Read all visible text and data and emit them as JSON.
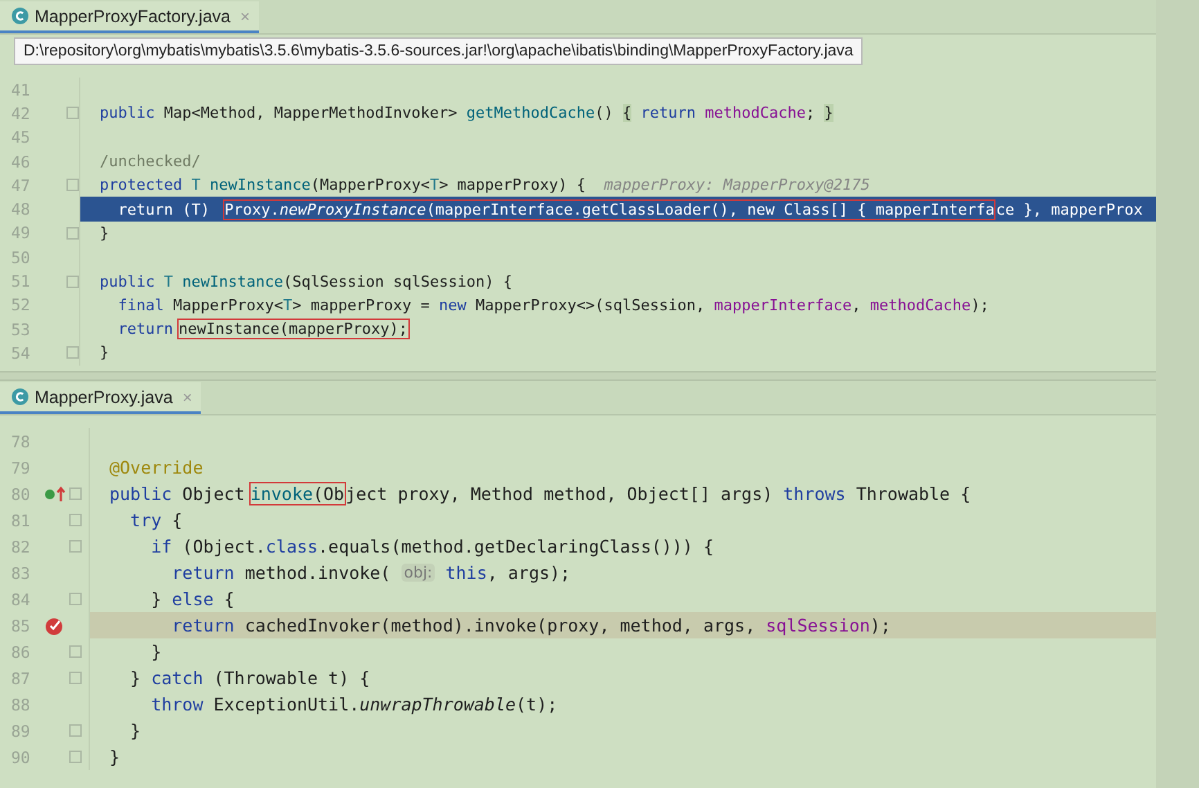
{
  "panes": [
    {
      "tab": {
        "title": "MapperProxyFactory.java",
        "close": "×",
        "selected": true
      },
      "tooltip": "D:\\repository\\org\\mybatis\\mybatis\\3.5.6\\mybatis-3.5.6-sources.jar!\\org\\apache\\ibatis\\binding\\MapperProxyFactory.java",
      "lines": [
        {
          "number": "41",
          "kind": "normal",
          "fold": false
        },
        {
          "number": "42",
          "kind": "normal",
          "fold": true,
          "code": [
            {
              "text": "public",
              "kind": "kw"
            },
            {
              "text": " Map<Method, MapperMethodInvoker> ",
              "kind": "plain"
            },
            {
              "text": "getMethodCache",
              "kind": "fn"
            },
            {
              "text": "() ",
              "kind": "plain"
            },
            {
              "text": "{",
              "kind": "fold"
            },
            {
              "text": " return",
              "kind": "kw"
            },
            {
              "text": " methodCache",
              "kind": "field"
            },
            {
              "text": "; ",
              "kind": "plain"
            },
            {
              "text": "}",
              "kind": "fold"
            }
          ]
        },
        {
          "number": "45",
          "kind": "normal",
          "fold": false
        },
        {
          "number": "46",
          "kind": "normal",
          "fold": false,
          "code": [
            {
              "text": "/unchecked/",
              "kind": "comment"
            }
          ]
        },
        {
          "number": "47",
          "kind": "normal",
          "fold": true,
          "code": [
            {
              "text": "protected",
              "kind": "kw"
            },
            {
              "text": " T",
              "kind": "tparam"
            },
            {
              "text": " newInstance",
              "kind": "fn"
            },
            {
              "text": "(MapperProxy<",
              "kind": "plain"
            },
            {
              "text": "T",
              "kind": "tparam"
            },
            {
              "text": "> mapperProxy) {",
              "kind": "plain"
            },
            {
              "text": "  mapperProxy: MapperProxy@2175",
              "kind": "debug"
            }
          ]
        },
        {
          "number": "48",
          "kind": "execution",
          "fold": false,
          "code": [
            {
              "text": "  return (T) ",
              "kind": "plain"
            }
          ],
          "boxed": [
            {
              "text": "Proxy.",
              "kind": "plain"
            },
            {
              "text": "newProxyInstance",
              "kind": "static"
            },
            {
              "text": "(mapperInterface.getClassLoader(), new Class[] { mapperInterfa",
              "kind": "plain"
            }
          ],
          "code_after": [
            {
              "text": "ce }, mapperProx",
              "kind": "plain"
            }
          ]
        },
        {
          "number": "49",
          "kind": "normal",
          "fold": true,
          "code": [
            {
              "text": "}",
              "kind": "plain"
            }
          ]
        },
        {
          "number": "50",
          "kind": "normal",
          "fold": false
        },
        {
          "number": "51",
          "kind": "normal",
          "fold": true,
          "code": [
            {
              "text": "public",
              "kind": "kw"
            },
            {
              "text": " T",
              "kind": "tparam"
            },
            {
              "text": " newInstance",
              "kind": "fn"
            },
            {
              "text": "(SqlSession sqlSession) {",
              "kind": "plain"
            }
          ]
        },
        {
          "number": "52",
          "kind": "normal",
          "fold": false,
          "code": [
            {
              "text": "  final",
              "kind": "kw"
            },
            {
              "text": " MapperProxy<",
              "kind": "plain"
            },
            {
              "text": "T",
              "kind": "tparam"
            },
            {
              "text": "> mapperProxy = ",
              "kind": "plain"
            },
            {
              "text": "new",
              "kind": "kw"
            },
            {
              "text": " MapperProxy<>(sqlSession, ",
              "kind": "plain"
            },
            {
              "text": "mapperInterface",
              "kind": "field"
            },
            {
              "text": ", ",
              "kind": "plain"
            },
            {
              "text": "methodCache",
              "kind": "field"
            },
            {
              "text": ");",
              "kind": "plain"
            }
          ]
        },
        {
          "number": "53",
          "kind": "normal",
          "fold": false,
          "code": [
            {
              "text": "  return",
              "kind": "kw"
            }
          ],
          "boxed": [
            {
              "text": "newInstance(mapperProxy);",
              "kind": "plain"
            }
          ]
        },
        {
          "number": "54",
          "kind": "normal",
          "fold": true,
          "code": [
            {
              "text": "}",
              "kind": "plain"
            }
          ]
        }
      ]
    },
    {
      "tab": {
        "title": "MapperProxy.java",
        "close": "×",
        "selected": true
      },
      "lines": [
        {
          "number": "78",
          "kind": "normal",
          "fold": false
        },
        {
          "number": "79",
          "kind": "normal",
          "fold": false,
          "code": [
            {
              "text": "@Override",
              "kind": "annotation"
            }
          ]
        },
        {
          "number": "80",
          "kind": "normal",
          "fold": true,
          "marker": {
            "kind": "override"
          },
          "code": [
            {
              "text": "public",
              "kind": "kw"
            },
            {
              "text": " Object",
              "kind": "plain"
            }
          ],
          "boxed": [
            {
              "text": "invoke",
              "kind": "fn"
            },
            {
              "text": "(Ob",
              "kind": "plain"
            }
          ],
          "code_after": [
            {
              "text": "ject proxy, Method method, Object[] args) ",
              "kind": "plain"
            },
            {
              "text": "throws",
              "kind": "kw"
            },
            {
              "text": " Throwable {",
              "kind": "plain"
            }
          ]
        },
        {
          "number": "81",
          "kind": "normal",
          "fold": true,
          "code": [
            {
              "text": "  try",
              "kind": "kw"
            },
            {
              "text": " {",
              "kind": "plain"
            }
          ]
        },
        {
          "number": "82",
          "kind": "normal",
          "fold": true,
          "code": [
            {
              "text": "    if",
              "kind": "kw"
            },
            {
              "text": " (Object.",
              "kind": "plain"
            },
            {
              "text": "class",
              "kind": "kw"
            },
            {
              "text": ".equals(method.getDeclaringClass())) {",
              "kind": "plain"
            }
          ]
        },
        {
          "number": "83",
          "kind": "normal",
          "fold": false,
          "code": [
            {
              "text": "      return",
              "kind": "kw"
            },
            {
              "text": " method.invoke( ",
              "kind": "plain"
            },
            {
              "text": "obj:",
              "kind": "inlay"
            },
            {
              "text": " this",
              "kind": "kw"
            },
            {
              "text": ", args);",
              "kind": "plain"
            }
          ]
        },
        {
          "number": "84",
          "kind": "normal",
          "fold": true,
          "code": [
            {
              "text": "    }",
              "kind": "plain"
            },
            {
              "text": " else",
              "kind": "kw"
            },
            {
              "text": " {",
              "kind": "plain"
            }
          ]
        },
        {
          "number": "85",
          "kind": "breakpoint",
          "fold": false,
          "code": [
            {
              "text": "      return",
              "kind": "kw"
            },
            {
              "text": " cachedInvoker(method).invoke(proxy, method, args, ",
              "kind": "plain"
            },
            {
              "text": "sqlSession",
              "kind": "field"
            },
            {
              "text": ");",
              "kind": "plain"
            }
          ]
        },
        {
          "number": "86",
          "kind": "normal",
          "fold": true,
          "code": [
            {
              "text": "    }",
              "kind": "plain"
            }
          ]
        },
        {
          "number": "87",
          "kind": "normal",
          "fold": true,
          "code": [
            {
              "text": "  }",
              "kind": "plain"
            },
            {
              "text": " catch",
              "kind": "kw"
            },
            {
              "text": " (Throwable t) {",
              "kind": "plain"
            }
          ]
        },
        {
          "number": "88",
          "kind": "normal",
          "fold": false,
          "code": [
            {
              "text": "    throw",
              "kind": "kw"
            },
            {
              "text": " ExceptionUtil.",
              "kind": "plain"
            },
            {
              "text": "unwrapThrowable",
              "kind": "static"
            },
            {
              "text": "(t);",
              "kind": "plain"
            }
          ]
        },
        {
          "number": "89",
          "kind": "normal",
          "fold": true,
          "code": [
            {
              "text": "  }",
              "kind": "plain"
            }
          ]
        },
        {
          "number": "90",
          "kind": "normal",
          "fold": true,
          "code": [
            {
              "text": "}",
              "kind": "plain"
            }
          ]
        }
      ]
    }
  ]
}
